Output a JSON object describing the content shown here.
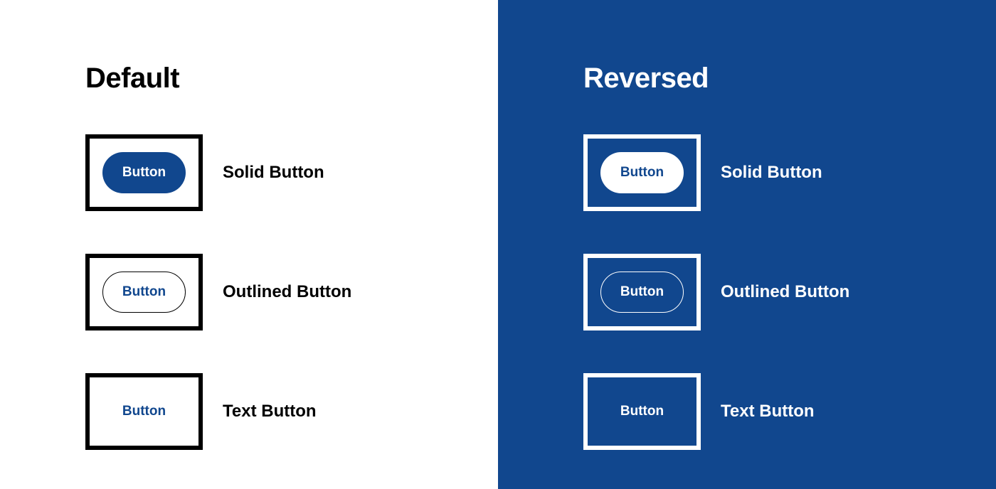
{
  "colors": {
    "brand_blue": "#11478e",
    "default_bg": "#ffffff",
    "default_text": "#000000",
    "reversed_bg": "#11478e",
    "reversed_text": "#ffffff"
  },
  "panels": {
    "default": {
      "title": "Default",
      "rows": [
        {
          "button_text": "Button",
          "variant": "solid",
          "label": "Solid Button"
        },
        {
          "button_text": "Button",
          "variant": "outlined",
          "label": "Outlined Button"
        },
        {
          "button_text": "Button",
          "variant": "text",
          "label": "Text Button"
        }
      ]
    },
    "reversed": {
      "title": "Reversed",
      "rows": [
        {
          "button_text": "Button",
          "variant": "solid",
          "label": "Solid Button"
        },
        {
          "button_text": "Button",
          "variant": "outlined",
          "label": "Outlined Button"
        },
        {
          "button_text": "Button",
          "variant": "text",
          "label": "Text Button"
        }
      ]
    }
  }
}
